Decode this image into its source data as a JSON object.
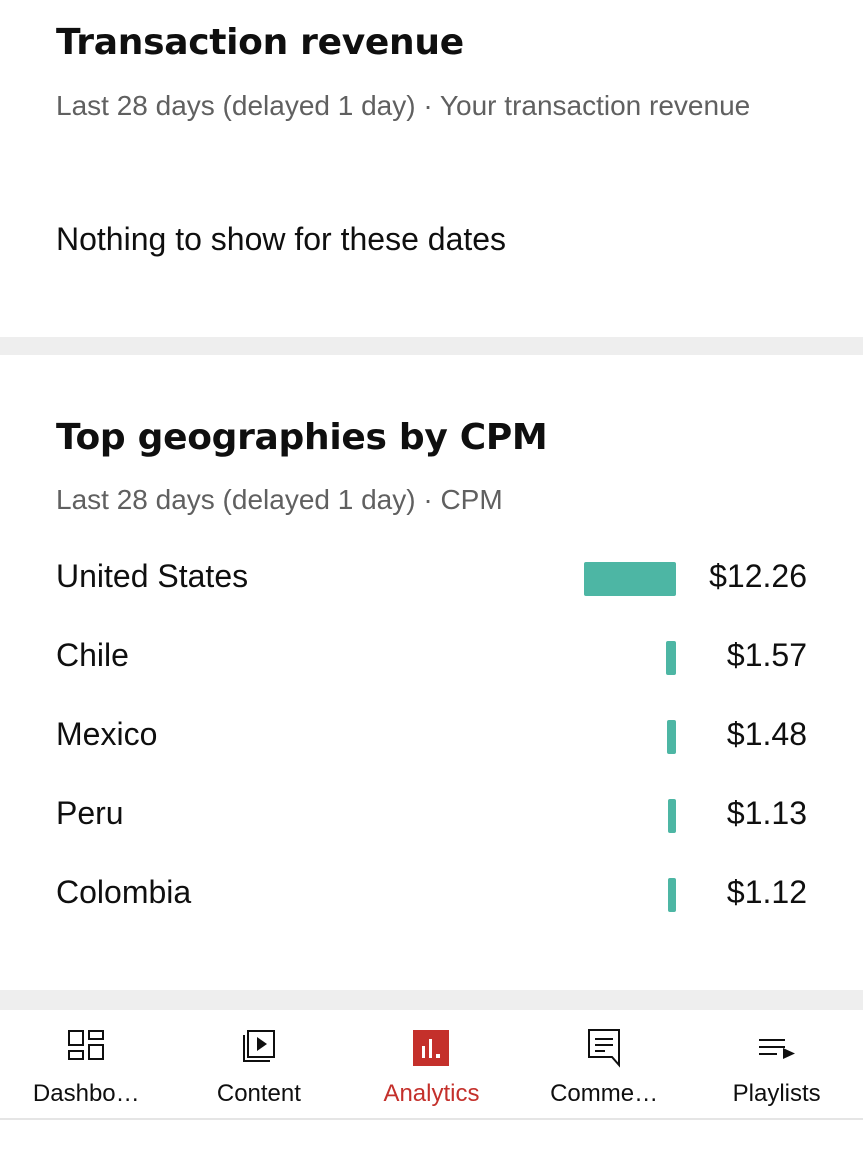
{
  "transaction_card": {
    "title": "Transaction revenue",
    "subtitle": "Last 28 days (delayed 1 day) · Your transaction revenue",
    "empty_message": "Nothing to show for these dates"
  },
  "geo_card": {
    "title": "Top geographies by CPM",
    "subtitle": "Last 28 days (delayed 1 day) · CPM",
    "bar_color": "#4db6a4",
    "rows": [
      {
        "country": "United States",
        "value": "$12.26",
        "cpm": 12.26
      },
      {
        "country": "Chile",
        "value": "$1.57",
        "cpm": 1.57
      },
      {
        "country": "Mexico",
        "value": "$1.48",
        "cpm": 1.48
      },
      {
        "country": "Peru",
        "value": "$1.13",
        "cpm": 1.13
      },
      {
        "country": "Colombia",
        "value": "$1.12",
        "cpm": 1.12
      }
    ]
  },
  "bottom_nav": {
    "active_color": "#c4302b",
    "items": [
      {
        "label": "Dashbo…",
        "icon": "dashboard-icon",
        "active": false
      },
      {
        "label": "Content",
        "icon": "content-icon",
        "active": false
      },
      {
        "label": "Analytics",
        "icon": "analytics-icon",
        "active": true
      },
      {
        "label": "Comme…",
        "icon": "comments-icon",
        "active": false
      },
      {
        "label": "Playlists",
        "icon": "playlists-icon",
        "active": false
      }
    ]
  }
}
